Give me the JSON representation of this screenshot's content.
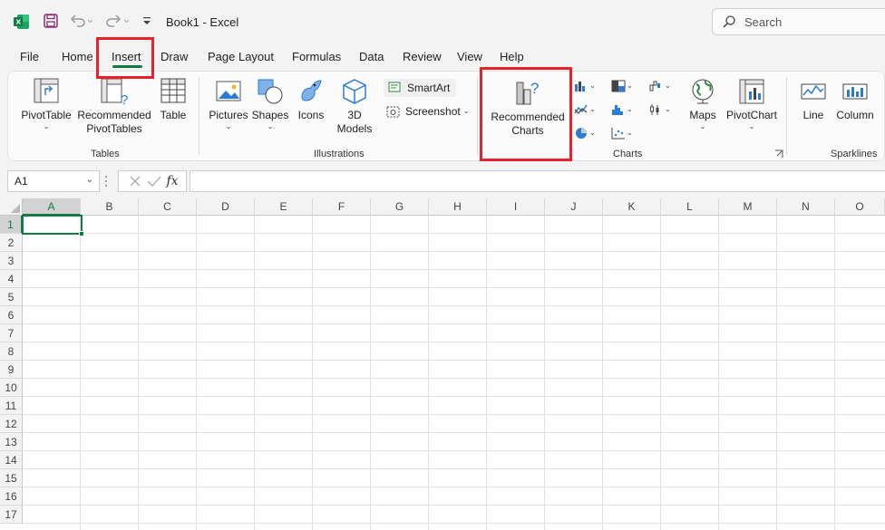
{
  "window": {
    "title": "Book1  -  Excel",
    "search_placeholder": "Search"
  },
  "tabs": [
    {
      "label": "File"
    },
    {
      "label": "Home"
    },
    {
      "label": "Insert"
    },
    {
      "label": "Draw"
    },
    {
      "label": "Page Layout"
    },
    {
      "label": "Formulas"
    },
    {
      "label": "Data"
    },
    {
      "label": "Review"
    },
    {
      "label": "View"
    },
    {
      "label": "Help"
    }
  ],
  "ribbon": {
    "tables": {
      "group_label": "Tables",
      "pivottable": "PivotTable",
      "recommended_pivottables_1": "Recommended",
      "recommended_pivottables_2": "PivotTables",
      "table": "Table"
    },
    "illustrations": {
      "group_label": "Illustrations",
      "pictures": "Pictures",
      "shapes": "Shapes",
      "icons": "Icons",
      "models_1": "3D",
      "models_2": "Models",
      "smartart": "SmartArt",
      "screenshot": "Screenshot"
    },
    "charts": {
      "group_label": "Charts",
      "recommended_1": "Recommended",
      "recommended_2": "Charts",
      "maps": "Maps",
      "pivotchart": "PivotChart"
    },
    "sparklines": {
      "group_label": "Sparklines",
      "line": "Line",
      "column": "Column"
    }
  },
  "formula_bar": {
    "name_box": "A1",
    "fx": "fx",
    "value": ""
  },
  "sheet": {
    "columns": [
      "A",
      "B",
      "C",
      "D",
      "E",
      "F",
      "G",
      "H",
      "I",
      "J",
      "K",
      "L",
      "M",
      "N",
      "O"
    ],
    "rows": [
      "1",
      "2",
      "3",
      "4",
      "5",
      "6",
      "7",
      "8",
      "9",
      "10",
      "11",
      "12",
      "13",
      "14",
      "15",
      "16",
      "17"
    ],
    "active_cell": "A1"
  },
  "colors": {
    "accent": "#107c41",
    "highlight": "#e8222b"
  }
}
